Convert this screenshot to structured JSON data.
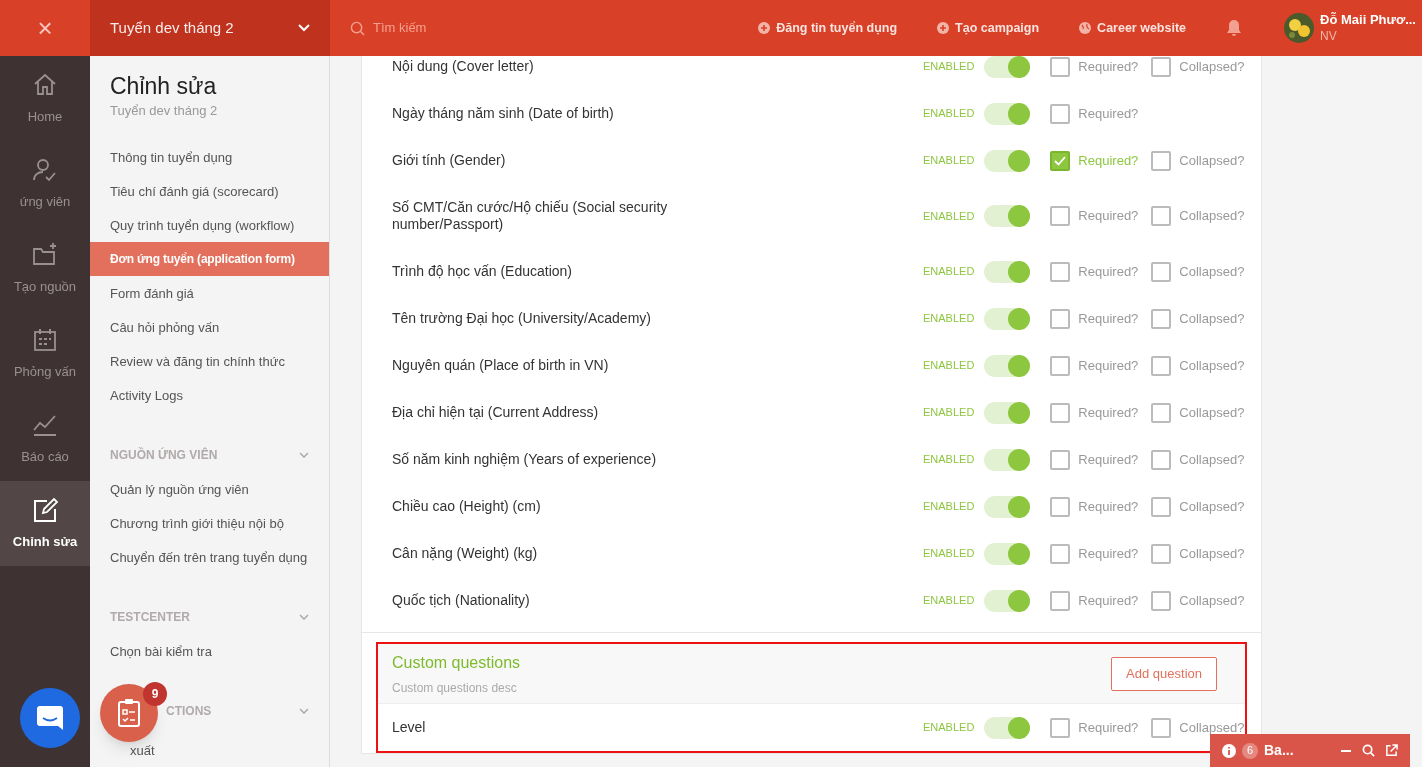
{
  "header": {
    "close": "×",
    "project": "Tuyển dev tháng 2",
    "search_placeholder": "Tìm kiếm",
    "actions": [
      {
        "kind": "plus",
        "label": "Đăng tin tuyển dụng"
      },
      {
        "kind": "plus",
        "label": "Tạo campaign"
      },
      {
        "kind": "globe",
        "label": "Career website"
      }
    ],
    "user": {
      "name": "Đỗ Maii Phươ...",
      "role": "NV"
    }
  },
  "rail": [
    {
      "kind": "home",
      "label": "Home",
      "selected": false
    },
    {
      "kind": "candidate",
      "label": "ứng viên",
      "selected": false
    },
    {
      "kind": "source",
      "label": "Tạo nguồn",
      "selected": false
    },
    {
      "kind": "interview",
      "label": "Phỏng vấn",
      "selected": false
    },
    {
      "kind": "report",
      "label": "Báo cáo",
      "selected": false
    },
    {
      "kind": "edit",
      "label": "Chỉnh sửa",
      "selected": true
    }
  ],
  "subnav": {
    "title": "Chỉnh sửa",
    "subtitle": "Tuyển dev tháng 2",
    "items": [
      {
        "label": "Thông tin tuyển dụng",
        "selected": false
      },
      {
        "label": "Tiêu chí đánh giá (scorecard)",
        "selected": false
      },
      {
        "label": "Quy trình tuyển dụng (workflow)",
        "selected": false
      },
      {
        "label": "Đơn ứng tuyển (application form)",
        "selected": true
      },
      {
        "label": "Form đánh giá",
        "selected": false
      },
      {
        "label": "Câu hỏi phỏng vấn",
        "selected": false
      },
      {
        "label": "Review và đăng tin chính thức",
        "selected": false
      },
      {
        "label": "Activity Logs",
        "selected": false
      }
    ],
    "sections": [
      {
        "heading": "NGUỒN ỨNG VIÊN",
        "items": [
          "Quản lý nguồn ứng viên",
          "Chương trình giới thiệu nội bộ",
          "Chuyển đến trên trang tuyển dụng"
        ]
      },
      {
        "heading": "TESTCENTER",
        "items": [
          "Chọn bài kiểm tra"
        ]
      },
      {
        "heading": "CTIONS",
        "items": [
          "xuất"
        ]
      }
    ]
  },
  "fields": [
    {
      "label": "Nội dung (Cover letter)",
      "status": "ENABLED",
      "on": true,
      "required": false,
      "required_label": "Required?",
      "collapsed": false,
      "collapsed_label": "Collapsed?"
    },
    {
      "label": "Ngày tháng năm sinh (Date of birth)",
      "status": "ENABLED",
      "on": true,
      "required": false,
      "required_label": "Required?"
    },
    {
      "label": "Giới tính (Gender)",
      "status": "ENABLED",
      "on": true,
      "required": true,
      "required_label": "Required?",
      "collapsed": false,
      "collapsed_label": "Collapsed?"
    },
    {
      "label": "Số CMT/Căn cước/Hộ chiếu (Social security number/Passport)",
      "status": "ENABLED",
      "on": true,
      "required": false,
      "required_label": "Required?",
      "collapsed": false,
      "collapsed_label": "Collapsed?"
    },
    {
      "label": "Trình độ học vấn (Education)",
      "status": "ENABLED",
      "on": true,
      "required": false,
      "required_label": "Required?",
      "collapsed": false,
      "collapsed_label": "Collapsed?"
    },
    {
      "label": "Tên trường Đại học (University/Academy)",
      "status": "ENABLED",
      "on": true,
      "required": false,
      "required_label": "Required?",
      "collapsed": false,
      "collapsed_label": "Collapsed?"
    },
    {
      "label": "Nguyên quán (Place of birth in VN)",
      "status": "ENABLED",
      "on": true,
      "required": false,
      "required_label": "Required?",
      "collapsed": false,
      "collapsed_label": "Collapsed?"
    },
    {
      "label": "Địa chỉ hiện tại (Current Address)",
      "status": "ENABLED",
      "on": true,
      "required": false,
      "required_label": "Required?",
      "collapsed": false,
      "collapsed_label": "Collapsed?"
    },
    {
      "label": "Số năm kinh nghiệm (Years of experience)",
      "status": "ENABLED",
      "on": true,
      "required": false,
      "required_label": "Required?",
      "collapsed": false,
      "collapsed_label": "Collapsed?"
    },
    {
      "label": "Chiều cao (Height) (cm)",
      "status": "ENABLED",
      "on": true,
      "required": false,
      "required_label": "Required?",
      "collapsed": false,
      "collapsed_label": "Collapsed?"
    },
    {
      "label": "Cân nặng (Weight) (kg)",
      "status": "ENABLED",
      "on": true,
      "required": false,
      "required_label": "Required?",
      "collapsed": false,
      "collapsed_label": "Collapsed?"
    },
    {
      "label": "Quốc tịch (Nationality)",
      "status": "ENABLED",
      "on": true,
      "required": false,
      "required_label": "Required?",
      "collapsed": false,
      "collapsed_label": "Collapsed?"
    }
  ],
  "custom": {
    "title": "Custom questions",
    "description": "Custom questions desc",
    "add_button": "Add question",
    "fields": [
      {
        "label": "Level",
        "status": "ENABLED",
        "on": true,
        "required": false,
        "required_label": "Required?",
        "collapsed": false,
        "collapsed_label": "Collapsed?"
      }
    ]
  },
  "task_badge": "9",
  "notice": {
    "count": "6",
    "label": "Ba..."
  }
}
